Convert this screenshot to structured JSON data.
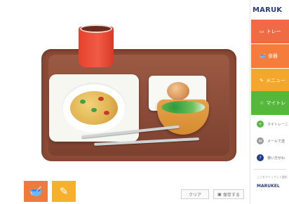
{
  "brand": {
    "name": "MARUK",
    "footer_logo": "MARUKEL"
  },
  "sidebar": {
    "tiles": [
      {
        "label": "トレー",
        "icon": "tray-icon",
        "color": "#ef6b45"
      },
      {
        "label": "食器",
        "icon": "bowl-icon",
        "color": "#f57c3a"
      },
      {
        "label": "メニュー",
        "icon": "menu-icon",
        "color": "#f4a72d"
      },
      {
        "label": "マイトレ",
        "icon": "star-icon",
        "color": "#55b83c"
      }
    ],
    "items": [
      {
        "label": "マイトレーニ",
        "icon": "plus-icon",
        "color": "#55b83c",
        "symbol": "+"
      },
      {
        "label": "メールで送",
        "icon": "mail-icon",
        "color": "#9a9a9a",
        "symbol": "✉"
      },
      {
        "label": "使い方がわ",
        "icon": "question-icon",
        "color": "#1f3d8a",
        "symbol": "?"
      }
    ],
    "small_text": "ここをクリックして選択"
  },
  "bottom_buttons": [
    {
      "icon": "bowl-icon",
      "color": "#f07a3a"
    },
    {
      "icon": "menu-icon",
      "color": "#f6b02b"
    }
  ],
  "action_buttons": [
    {
      "label": "クリア",
      "icon": ""
    },
    {
      "label": "保存する",
      "icon": "save-icon"
    }
  ]
}
